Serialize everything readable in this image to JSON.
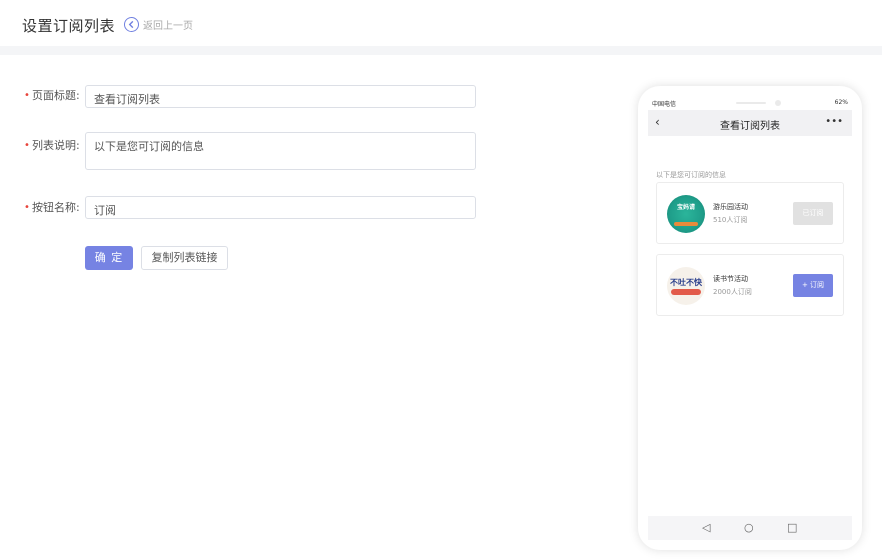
{
  "header": {
    "title": "设置订阅列表",
    "back_label": "返回上一页",
    "back_icon": "chevron-left-circle-icon"
  },
  "form": {
    "page_title_label": "页面标题",
    "page_title_value": "查看订阅列表",
    "list_desc_label": "列表说明",
    "list_desc_value": "以下是您可订阅的信息",
    "button_name_label": "按钮名称",
    "button_name_value": "订阅",
    "required_mark": "•",
    "colon": ":"
  },
  "actions": {
    "confirm_label": "确 定",
    "copy_link_label": "复制列表链接"
  },
  "colors": {
    "accent": "#7683e3",
    "required": "#e8453c"
  },
  "phone": {
    "status_left": "中国电信",
    "status_right": "62%",
    "nav_back": "‹",
    "nav_title": "查看订阅列表",
    "nav_more": "•••",
    "list_desc": "以下是您可订阅的信息",
    "items": [
      {
        "title": "游乐园活动",
        "count": "510人订阅",
        "button": "已订阅",
        "subscribed": true,
        "img_text": "宝妈请"
      },
      {
        "title": "读书节活动",
        "count": "2000人订阅",
        "button": "+ 订阅",
        "subscribed": false,
        "img_text": "不吐不快"
      }
    ],
    "nav_buttons": [
      "◁",
      "○",
      "□"
    ]
  }
}
